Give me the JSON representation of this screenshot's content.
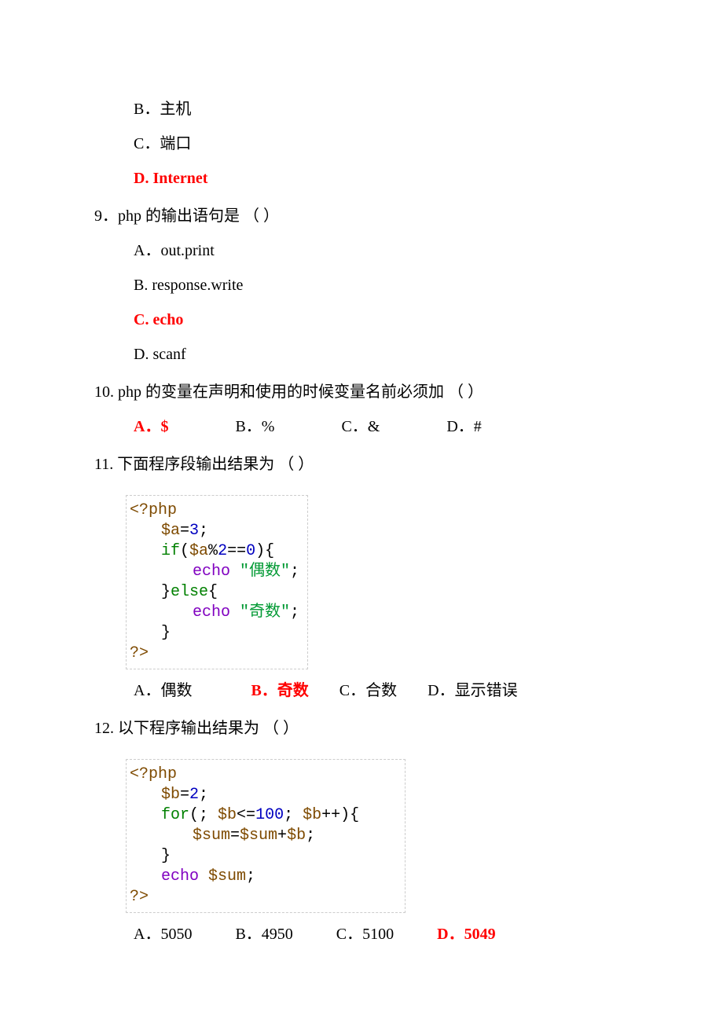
{
  "q8_opts": {
    "b": "B．主机",
    "c": "C．端口",
    "d": "D. Internet"
  },
  "q9": {
    "text": "9．php 的输出语句是  （    ）",
    "a": "A．out.print",
    "b": "B. response.write",
    "c": "C. echo",
    "d": "D. scanf"
  },
  "q10": {
    "text": "10. php 的变量在声明和使用的时候变量名前必须加 （     ）",
    "a": "A．$",
    "b": "B．%",
    "c": "C．&",
    "d": "D．#"
  },
  "q11": {
    "text": "11. 下面程序段输出结果为 （     ）",
    "code": {
      "l1a": "<?php",
      "l2a": "$a",
      "l2b": "=",
      "l2c": "3",
      "l2d": ";",
      "l3a": "if",
      "l3b": "(",
      "l3c": "$a",
      "l3d": "%",
      "l3e": "2",
      "l3f": "==",
      "l3g": "0",
      "l3h": "){",
      "l4a": "echo",
      "l4b": " \"偶数\"",
      "l4c": ";",
      "l5a": "}",
      "l5b": "else",
      "l5c": "{",
      "l6a": "echo",
      "l6b": " \"奇数\"",
      "l6c": ";",
      "l7a": "}",
      "l8a": "?>"
    },
    "opts": {
      "a": "A．偶数",
      "b": "B．奇数",
      "c": "C．合数",
      "d": "D．显示错误"
    }
  },
  "q12": {
    "text": "12. 以下程序输出结果为  （    ）",
    "code": {
      "l1a": "<?php",
      "l2a": "$b",
      "l2b": "=",
      "l2c": "2",
      "l2d": ";",
      "l3a": "for",
      "l3b": "(; ",
      "l3c": "$b",
      "l3d": "<=",
      "l3e": "100",
      "l3f": "; ",
      "l3g": "$b",
      "l3h": "++){",
      "l4a": "$sum",
      "l4b": "=",
      "l4c": "$sum",
      "l4d": "+",
      "l4e": "$b",
      "l4f": ";",
      "l5a": "}",
      "l6a": "echo",
      "l6b": " $sum",
      "l6c": ";",
      "l7a": "?>"
    },
    "opts": {
      "a": "A．5050",
      "b": "B．4950",
      "c": "C．5100",
      "d": "D．5049"
    }
  }
}
